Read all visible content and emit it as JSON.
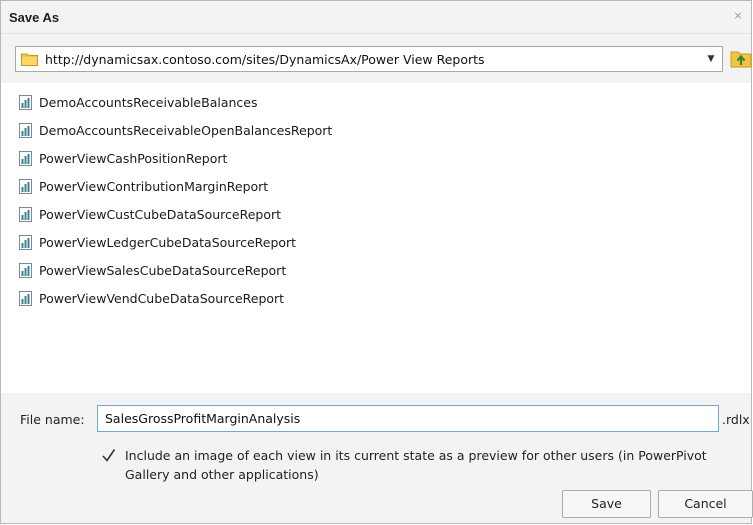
{
  "dialog": {
    "title": "Save As",
    "close_glyph": "⨯"
  },
  "location": {
    "path": "http://dynamicsax.contoso.com/sites/DynamicsAx/Power View Reports",
    "dropdown_glyph": "▼"
  },
  "files": [
    {
      "name": "DemoAccountsReceivableBalances"
    },
    {
      "name": "DemoAccountsReceivableOpenBalancesReport"
    },
    {
      "name": "PowerViewCashPositionReport"
    },
    {
      "name": "PowerViewContributionMarginReport"
    },
    {
      "name": "PowerViewCustCubeDataSourceReport"
    },
    {
      "name": "PowerViewLedgerCubeDataSourceReport"
    },
    {
      "name": "PowerViewSalesCubeDataSourceReport"
    },
    {
      "name": "PowerViewVendCubeDataSourceReport"
    }
  ],
  "filename": {
    "label": "File name:",
    "value": "SalesGrossProfitMarginAnalysis",
    "extension": ".rdlx"
  },
  "preview_option": {
    "checked": true,
    "check_glyph": "✓",
    "text": "Include an image of each view in its current state as a preview for other users (in PowerPivot Gallery and other applications)"
  },
  "buttons": {
    "save": "Save",
    "cancel": "Cancel"
  },
  "icons": {
    "folder": "folder-icon",
    "up": "up-folder-icon",
    "file": "report-file-icon",
    "close": "close-icon",
    "dropdown": "chevron-down-icon"
  }
}
